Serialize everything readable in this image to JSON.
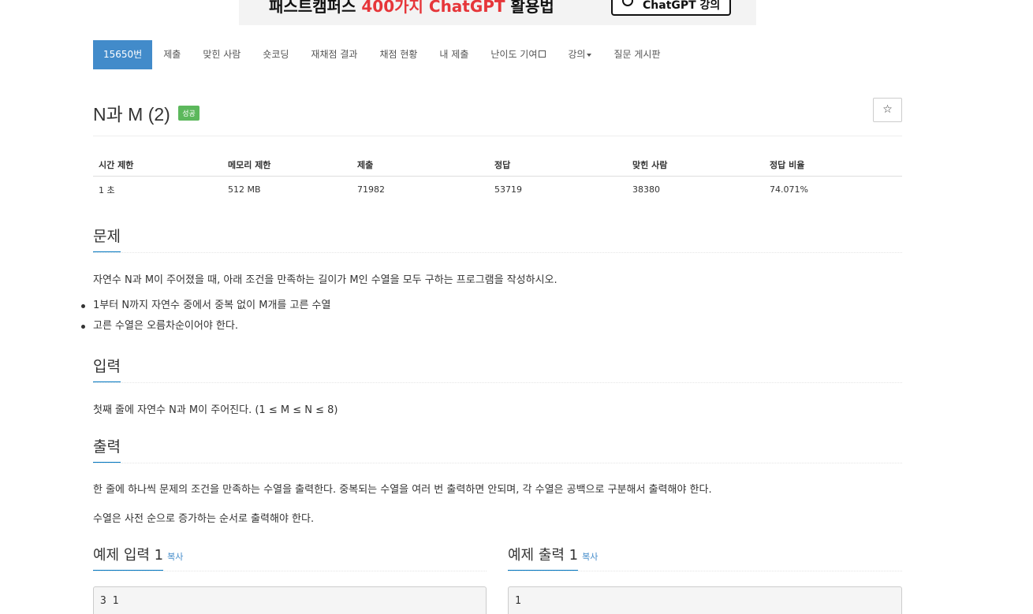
{
  "banner": {
    "text_prefix": "패스트캠퍼스 ",
    "text_highlight": "400가지 ChatGPT",
    "text_suffix": " 활용법",
    "button_label": "ChatGPT 강의"
  },
  "nav": {
    "items": [
      {
        "label": "15650번"
      },
      {
        "label": "제출"
      },
      {
        "label": "맞힌 사람"
      },
      {
        "label": "숏코딩"
      },
      {
        "label": "재채점 결과"
      },
      {
        "label": "채점 현황"
      },
      {
        "label": "내 제출"
      },
      {
        "label": "난이도 기여"
      },
      {
        "label": "강의"
      },
      {
        "label": "질문 게시판"
      }
    ]
  },
  "problem": {
    "title": "N과 M (2)",
    "badge": "성공",
    "star": "☆"
  },
  "info_table": {
    "headers": [
      "시간 제한",
      "메모리 제한",
      "제출",
      "정답",
      "맞힌 사람",
      "정답 비율"
    ],
    "values": [
      "1 초",
      "512 MB",
      "71982",
      "53719",
      "38380",
      "74.071%"
    ]
  },
  "description": {
    "heading": "문제",
    "text": "자연수 N과 M이 주어졌을 때, 아래 조건을 만족하는 길이가 M인 수열을 모두 구하는 프로그램을 작성하시오.",
    "bullets": [
      "1부터 N까지 자연수 중에서 중복 없이 M개를 고른 수열",
      "고른 수열은 오름차순이어야 한다."
    ]
  },
  "input": {
    "heading": "입력",
    "text": "첫째 줄에 자연수 N과 M이 주어진다. (1 ≤ M ≤ N ≤ 8)"
  },
  "output": {
    "heading": "출력",
    "text1": "한 줄에 하나씩 문제의 조건을 만족하는 수열을 출력한다. 중복되는 수열을 여러 번 출력하면 안되며, 각 수열은 공백으로 구분해서 출력해야 한다.",
    "text2": "수열은 사전 순으로 증가하는 순서로 출력해야 한다."
  },
  "examples": {
    "input": {
      "heading": "예제 입력 1",
      "copy": "복사",
      "content": "3 1"
    },
    "output": {
      "heading": "예제 출력 1",
      "copy": "복사",
      "content": "1"
    }
  }
}
